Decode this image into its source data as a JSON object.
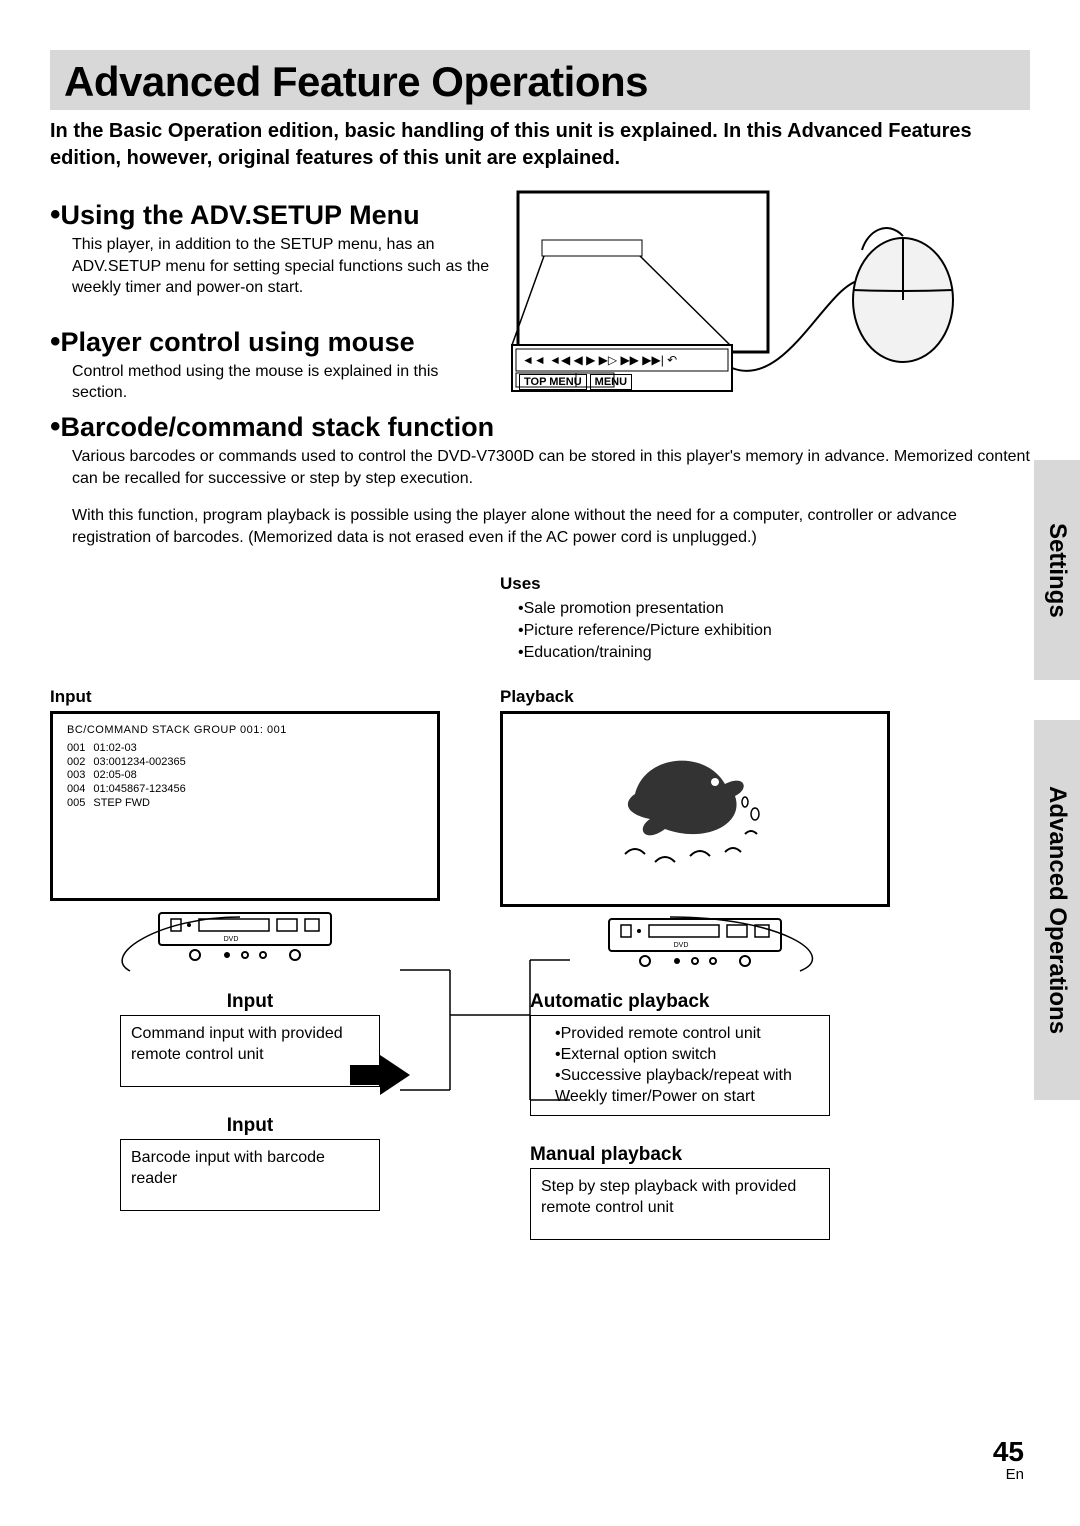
{
  "title": "Advanced Feature Operations",
  "intro": "In the Basic Operation edition, basic handling of this unit is explained. In this Advanced Features edition, however, original features of this unit are explained.",
  "s1": {
    "heading": "Using the ADV.SETUP Menu",
    "body": "This player, in addition to the SETUP menu, has an ADV.SETUP menu for setting special functions such as the weekly timer and power-on start."
  },
  "s2": {
    "heading": "Player control using mouse",
    "body": "Control method using the mouse is explained in this section."
  },
  "s3": {
    "heading": "Barcode/command stack function",
    "body1": "Various barcodes or commands used to control the DVD-V7300D can be stored in this player's memory in advance. Memorized content can be recalled for successive or step by step execution.",
    "body2": "With this function, program playback is possible using the player alone without the need for a computer, controller or advance registration of barcodes. (Memorized data is not erased even if the AC power cord is unplugged.)"
  },
  "uses": {
    "heading": "Uses",
    "items": [
      "Sale promotion presentation",
      "Picture reference/Picture exhibition",
      "Education/training"
    ]
  },
  "inputLabel": "Input",
  "playbackLabel": "Playback",
  "screen": {
    "title": "BC/COMMAND STACK  GROUP  001: 001",
    "rows": [
      [
        "001",
        "01:02-03"
      ],
      [
        "002",
        "03:001234-002365"
      ],
      [
        "003",
        "02:05-08"
      ],
      [
        "004",
        "01:045867-123456"
      ],
      [
        "005",
        "STEP FWD"
      ]
    ]
  },
  "box_input1": {
    "heading": "Input",
    "body": "Command input with provided remote control unit"
  },
  "box_input2": {
    "heading": "Input",
    "body": "Barcode input with barcode reader"
  },
  "box_auto": {
    "heading": "Automatic playback",
    "items": [
      "Provided remote control unit",
      "External option switch",
      "Successive playback/repeat with Weekly timer/Power on start"
    ]
  },
  "box_manual": {
    "heading": "Manual playback",
    "body": "Step by step playback with provided remote control unit"
  },
  "controlBar": {
    "topMenu": "TOP MENU",
    "menu": "MENU"
  },
  "sideTabs": {
    "settings": "Settings",
    "advOps": "Advanced Operations"
  },
  "pageNumber": "45",
  "langCode": "En"
}
